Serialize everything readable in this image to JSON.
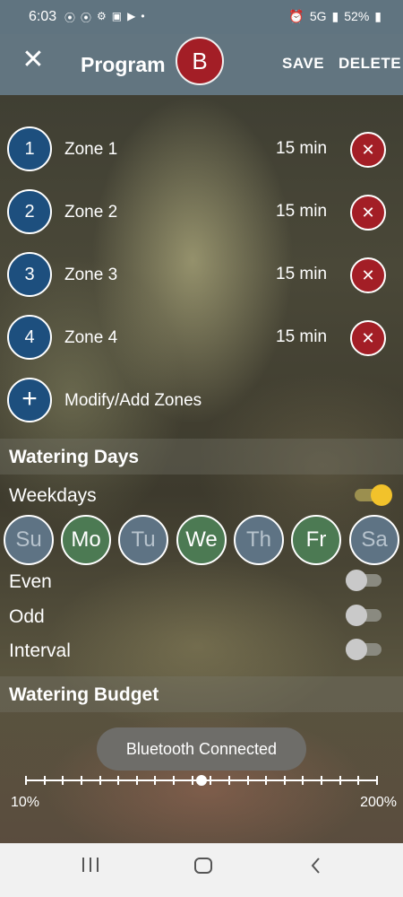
{
  "status_bar": {
    "time": "6:03",
    "network": "5G",
    "battery": "52%",
    "notification_icons": [
      "messenger-icon",
      "messenger-icon",
      "gear-icon",
      "voicemail-icon",
      "youtube-icon",
      "dot-icon"
    ]
  },
  "app_bar": {
    "title": "Program",
    "program_letter": "B",
    "save_label": "SAVE",
    "delete_label": "DELETE"
  },
  "zones": [
    {
      "number": "1",
      "name": "Zone 1",
      "duration": "15 min"
    },
    {
      "number": "2",
      "name": "Zone 2",
      "duration": "15 min"
    },
    {
      "number": "3",
      "name": "Zone 3",
      "duration": "15 min"
    },
    {
      "number": "4",
      "name": "Zone 4",
      "duration": "15 min"
    }
  ],
  "modify_zones_label": "Modify/Add Zones",
  "watering_days": {
    "heading": "Watering Days",
    "weekdays_label": "Weekdays",
    "weekdays_on": true,
    "days": [
      {
        "label": "Su",
        "active": false
      },
      {
        "label": "Mo",
        "active": true
      },
      {
        "label": "Tu",
        "active": false
      },
      {
        "label": "We",
        "active": true
      },
      {
        "label": "Th",
        "active": false
      },
      {
        "label": "Fr",
        "active": true
      },
      {
        "label": "Sa",
        "active": false
      }
    ],
    "even_label": "Even",
    "even_on": false,
    "odd_label": "Odd",
    "odd_on": false,
    "interval_label": "Interval",
    "interval_on": false
  },
  "watering_budget": {
    "heading": "Watering Budget",
    "min_label": "10%",
    "max_label": "200%",
    "value_fraction": 0.5
  },
  "toast": "Bluetooth Connected",
  "colors": {
    "accent_red": "#a31e26",
    "zone_blue": "#1d4f7e",
    "day_active": "#4c7a53",
    "day_inactive": "#5e7384",
    "toggle_on": "#f2c22b"
  }
}
